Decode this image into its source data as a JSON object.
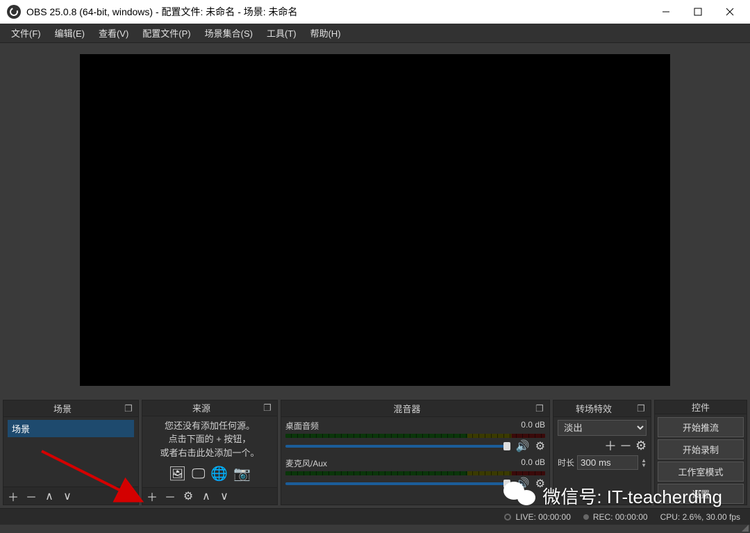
{
  "window": {
    "title": "OBS 25.0.8 (64-bit, windows) - 配置文件: 未命名 - 场景: 未命名"
  },
  "menu": {
    "file": "文件(F)",
    "edit": "编辑(E)",
    "view": "查看(V)",
    "profile": "配置文件(P)",
    "scenecoll": "场景集合(S)",
    "tools": "工具(T)",
    "help": "帮助(H)"
  },
  "docks": {
    "scenes": {
      "title": "场景",
      "item": "场景"
    },
    "sources": {
      "title": "来源",
      "line1": "您还没有添加任何源。",
      "line2": "点击下面的 + 按钮，",
      "line3": "或者右击此处添加一个。"
    },
    "mixer": {
      "title": "混音器",
      "ch1": {
        "name": "桌面音频",
        "db": "0.0 dB"
      },
      "ch2": {
        "name": "麦克风/Aux",
        "db": "0.0 dB"
      }
    },
    "transitions": {
      "title": "转场特效",
      "selected": "淡出",
      "duration_label": "时长",
      "duration_value": "300 ms"
    },
    "controls": {
      "title": "控件",
      "stream": "开始推流",
      "record": "开始录制",
      "studio": "工作室模式",
      "settings": "设置"
    }
  },
  "status": {
    "live": "LIVE: 00:00:00",
    "rec": "REC: 00:00:00",
    "cpu": "CPU: 2.6%, 30.00 fps"
  },
  "overlay": {
    "wechat": "微信号: IT-teacherding"
  }
}
